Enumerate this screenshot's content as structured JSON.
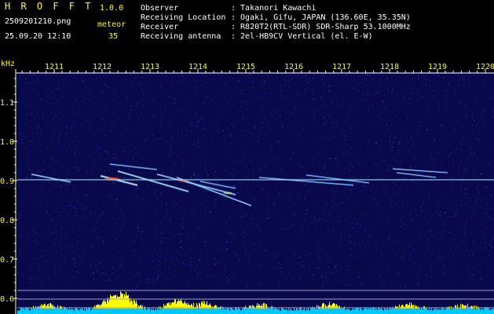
{
  "header": {
    "app_title": "H R O F F T",
    "version": "1.0.0",
    "filename": "2509201210.png",
    "datetime": "25.09.20 12:10",
    "meteor_label": "meteor",
    "meteor_count": "35",
    "info": [
      {
        "label": "Observer",
        "value": ": Takanori Kawachi"
      },
      {
        "label": "Receiving Location",
        "value": ": Ogaki, Gifu, JAPAN (136.60E, 35.35N)"
      },
      {
        "label": "Receiver",
        "value": ": R820T2(RTL-SDR) SDR-Sharp 53.1000MHz"
      },
      {
        "label": "Receiving antenna",
        "value": ": 2el-HB9CV Vertical (el. E-W)"
      }
    ]
  },
  "spectrogram": {
    "y_unit": "kHz",
    "y_ticks": [
      "1.1",
      "1.0",
      "0.9",
      "0.8",
      "0.7",
      "0.6"
    ],
    "x_ticks": [
      "1211",
      "1212",
      "1213",
      "1214",
      "1215",
      "1216",
      "1217",
      "1218",
      "1219",
      "1220"
    ],
    "colors": {
      "background": "#08084a",
      "carrier": "#9fe8ff",
      "echo_core": "#ffffff",
      "echo_hot": "#ff4020",
      "level_fill": "#00c8ff",
      "level_peak": "#ffff00"
    }
  }
}
